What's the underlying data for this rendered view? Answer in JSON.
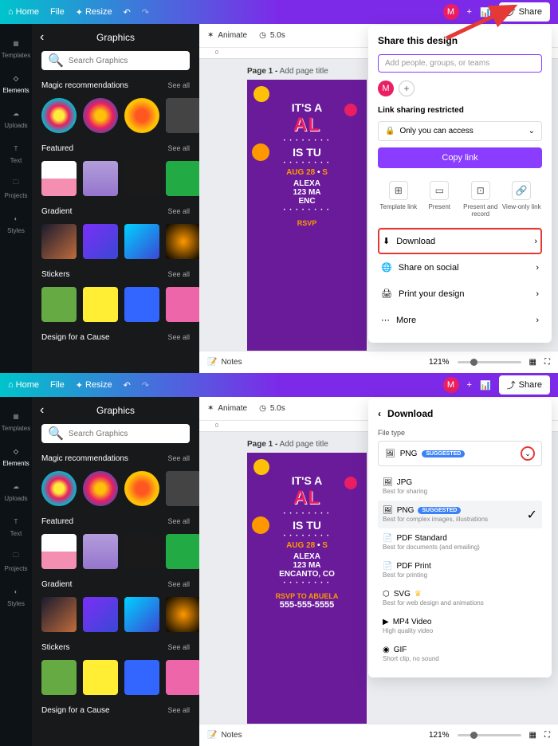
{
  "topbar": {
    "home": "Home",
    "file": "File",
    "resize": "Resize",
    "share": "Share",
    "avatar_letter": "M"
  },
  "sidebar_nav": {
    "templates": "Templates",
    "elements": "Elements",
    "uploads": "Uploads",
    "text": "Text",
    "projects": "Projects",
    "styles": "Styles"
  },
  "graphics_panel": {
    "title": "Graphics",
    "search_placeholder": "Search Graphics",
    "see_all": "See all",
    "sections": {
      "magic": "Magic recommendations",
      "featured": "Featured",
      "gradient": "Gradient",
      "stickers": "Stickers",
      "cause": "Design for a Cause"
    }
  },
  "canvas": {
    "animate": "Animate",
    "duration": "5.0s",
    "page_label_bold": "Page 1 -",
    "page_label_rest": "Add page title",
    "notes": "Notes",
    "zoom": "121%"
  },
  "flyer": {
    "its_a": "IT'S A",
    "name": "AL",
    "is_tu": "IS TU",
    "date": "AUG 28",
    "sep": "S",
    "alexa": "ALEXA",
    "addr1": "123 MA",
    "addr2": "ENC",
    "encanto": "ENCANTO, CO",
    "rsvp": "RSVP",
    "rsvp_full": "RSVP TO ABUELA",
    "phone": "555-555-5555"
  },
  "share_panel": {
    "title": "Share this design",
    "input_placeholder": "Add people, groups, or teams",
    "avatar_letter": "M",
    "link_restricted": "Link sharing restricted",
    "access": "Only you can access",
    "copy_link": "Copy link",
    "template_link": "Template link",
    "present": "Present",
    "present_record": "Present and record",
    "view_only": "View-only link",
    "download": "Download",
    "share_social": "Share on social",
    "print_design": "Print your design",
    "more": "More"
  },
  "download_panel": {
    "title": "Download",
    "filetype_label": "File type",
    "selected": "PNG",
    "suggested": "SUGGESTED",
    "options": [
      {
        "name": "JPG",
        "desc": "Best for sharing"
      },
      {
        "name": "PNG",
        "desc": "Best for complex images, illustrations",
        "suggested": true,
        "selected": true
      },
      {
        "name": "PDF Standard",
        "desc": "Best for documents (and emailing)"
      },
      {
        "name": "PDF Print",
        "desc": "Best for printing"
      },
      {
        "name": "SVG",
        "desc": "Best for web design and animations",
        "pro": true
      },
      {
        "name": "MP4 Video",
        "desc": "High quality video"
      },
      {
        "name": "GIF",
        "desc": "Short clip, no sound"
      }
    ]
  }
}
